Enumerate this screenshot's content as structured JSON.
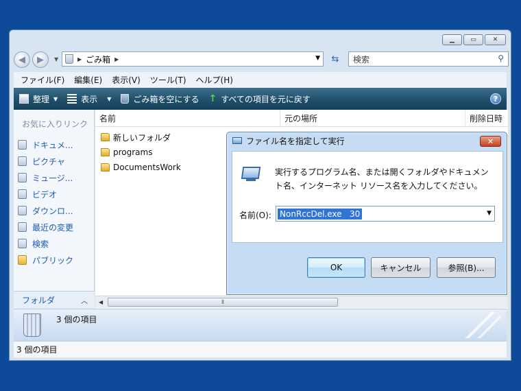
{
  "explorer": {
    "address": {
      "location": "ごみ箱"
    },
    "search": {
      "placeholder": "検索"
    },
    "menu": [
      "ファイル(F)",
      "編集(E)",
      "表示(V)",
      "ツール(T)",
      "ヘルプ(H)"
    ],
    "toolbar": {
      "organize": "整理",
      "views": "表示",
      "empty_bin": "ごみ箱を空にする",
      "restore_all": "すべての項目を元に戻す"
    },
    "nav": {
      "favorites_title": "お気に入りリンク",
      "items": [
        "ドキュメ...",
        "ピクチャ",
        "ミュージ...",
        "ビデオ",
        "ダウンロ...",
        "最近の変更",
        "検索",
        "パブリック"
      ],
      "folders_label": "フォルダ"
    },
    "columns": [
      "名前",
      "元の場所",
      "削除日時"
    ],
    "files": [
      "新しいフォルダ",
      "programs",
      "DocumentsWork"
    ],
    "details": {
      "count": "3 個の項目"
    },
    "status": "3 個の項目"
  },
  "run_dialog": {
    "title": "ファイル名を指定して実行",
    "description_line1": "実行するプログラム名、または開くフォルダやドキュメン",
    "description_line2": "ト名、インターネット リソース名を入力してください。",
    "name_label": "名前(O):",
    "command": "NonRccDel.exe   30",
    "ok": "OK",
    "cancel": "キャンセル",
    "browse": "参照(B)..."
  }
}
